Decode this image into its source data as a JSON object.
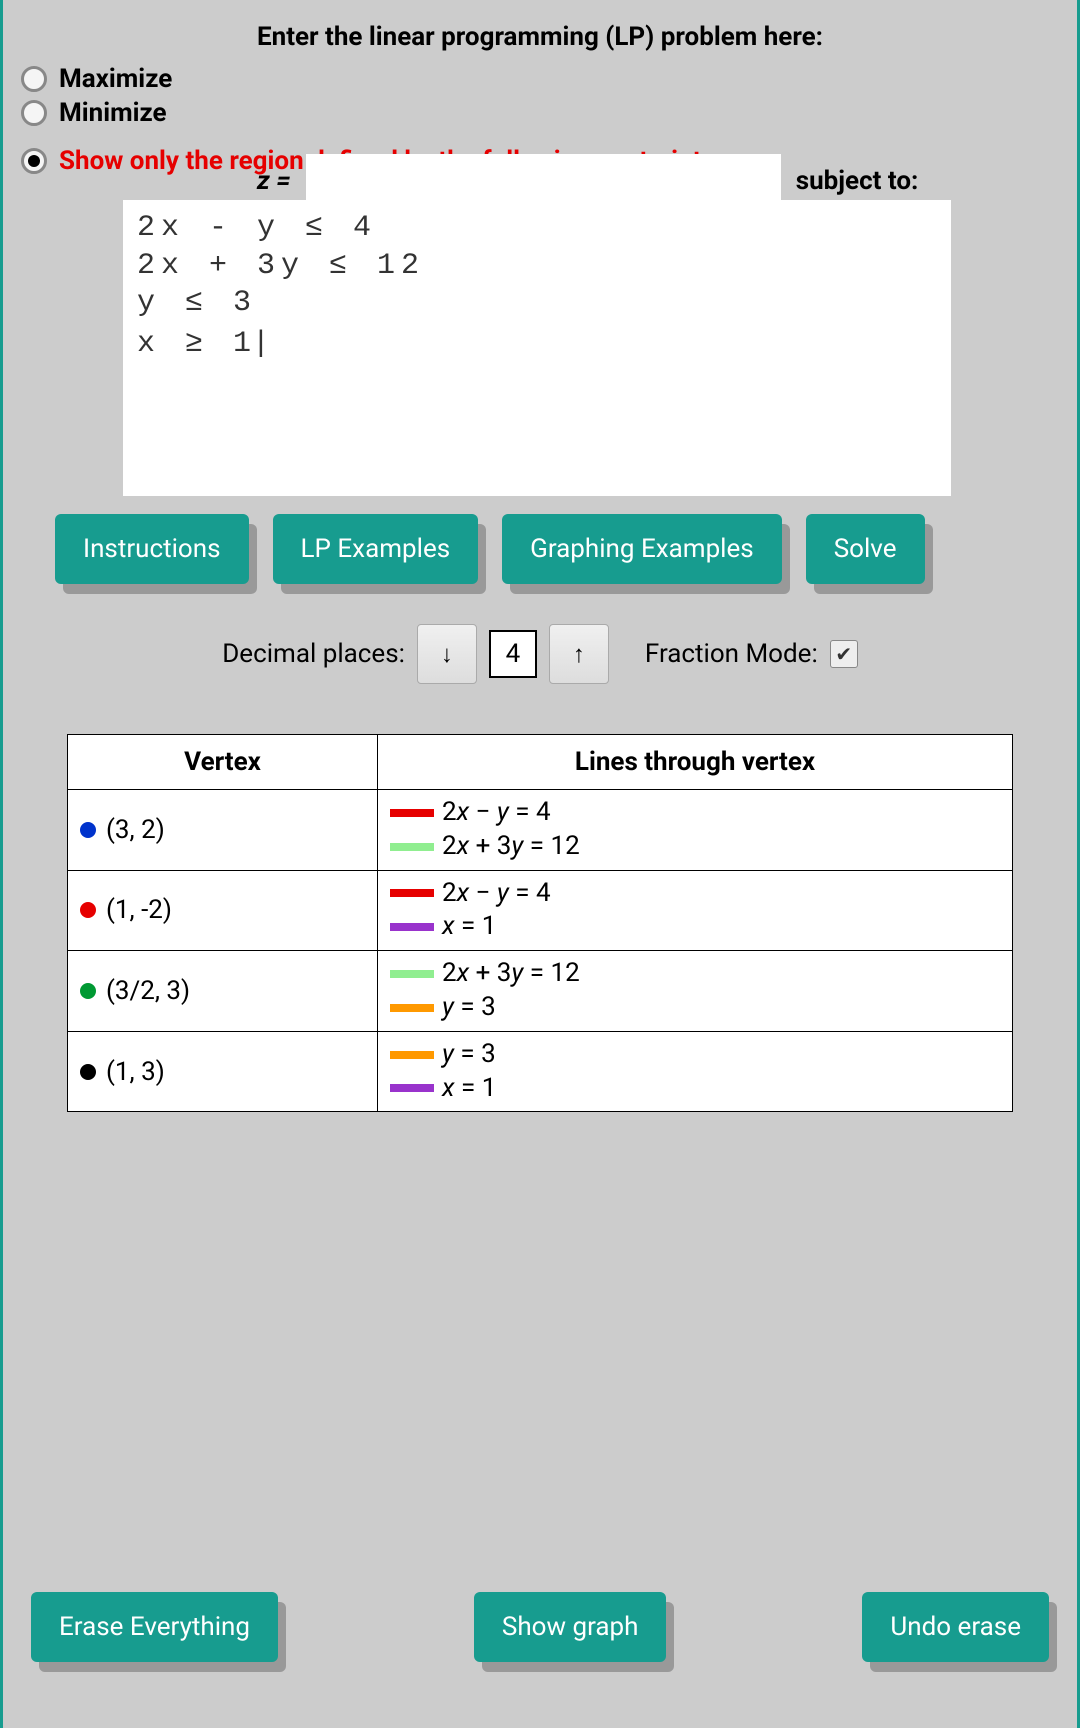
{
  "title": "Enter the linear programming (LP) problem here:",
  "radios": {
    "maximize": "Maximize",
    "minimize": "Minimize",
    "region_only": "Show only the region defined by the following contraints:",
    "selected": "region_only"
  },
  "objective": {
    "z_eq": "z =",
    "value": "",
    "subject_to": "subject to:"
  },
  "constraints_text": "2x - y ≤ 4\n2x + 3y ≤ 12\ny ≤ 3\nx ≥ 1",
  "buttons": {
    "instructions": "Instructions",
    "lp_examples": "LP Examples",
    "graphing_examples": "Graphing Examples",
    "solve": "Solve",
    "erase": "Erase Everything",
    "show_graph": "Show graph",
    "undo_erase": "Undo erase"
  },
  "decimal": {
    "label": "Decimal places:",
    "down": "↓",
    "value": "4",
    "up": "↑"
  },
  "fraction": {
    "label": "Fraction Mode:",
    "checked": true,
    "checkmark": "✔"
  },
  "table": {
    "headers": {
      "vertex": "Vertex",
      "lines": "Lines through vertex"
    },
    "rows": [
      {
        "dot_color": "#0033cc",
        "vertex": "(3, 2)",
        "lines": [
          {
            "color": "#e60000",
            "var_a": "2x",
            "mid": " − ",
            "var_b": "y",
            "rest": " = 4"
          },
          {
            "color": "#90ee90",
            "var_a": "2x",
            "mid": " + 3",
            "var_b": "y",
            "rest": " = 12"
          }
        ]
      },
      {
        "dot_color": "#e60000",
        "vertex": "(1, -2)",
        "lines": [
          {
            "color": "#e60000",
            "var_a": "2x",
            "mid": " − ",
            "var_b": "y",
            "rest": " = 4"
          },
          {
            "color": "#9933cc",
            "var_a": "x",
            "mid": "",
            "var_b": "",
            "rest": " = 1"
          }
        ]
      },
      {
        "dot_color": "#009933",
        "vertex": "(3/2, 3)",
        "lines": [
          {
            "color": "#90ee90",
            "var_a": "2x",
            "mid": " + 3",
            "var_b": "y",
            "rest": " = 12"
          },
          {
            "color": "#ff9900",
            "var_a": "y",
            "mid": "",
            "var_b": "",
            "rest": " = 3"
          }
        ]
      },
      {
        "dot_color": "#000000",
        "vertex": "(1, 3)",
        "lines": [
          {
            "color": "#ff9900",
            "var_a": "y",
            "mid": "",
            "var_b": "",
            "rest": " = 3"
          },
          {
            "color": "#9933cc",
            "var_a": "x",
            "mid": "",
            "var_b": "",
            "rest": " = 1"
          }
        ]
      }
    ]
  }
}
